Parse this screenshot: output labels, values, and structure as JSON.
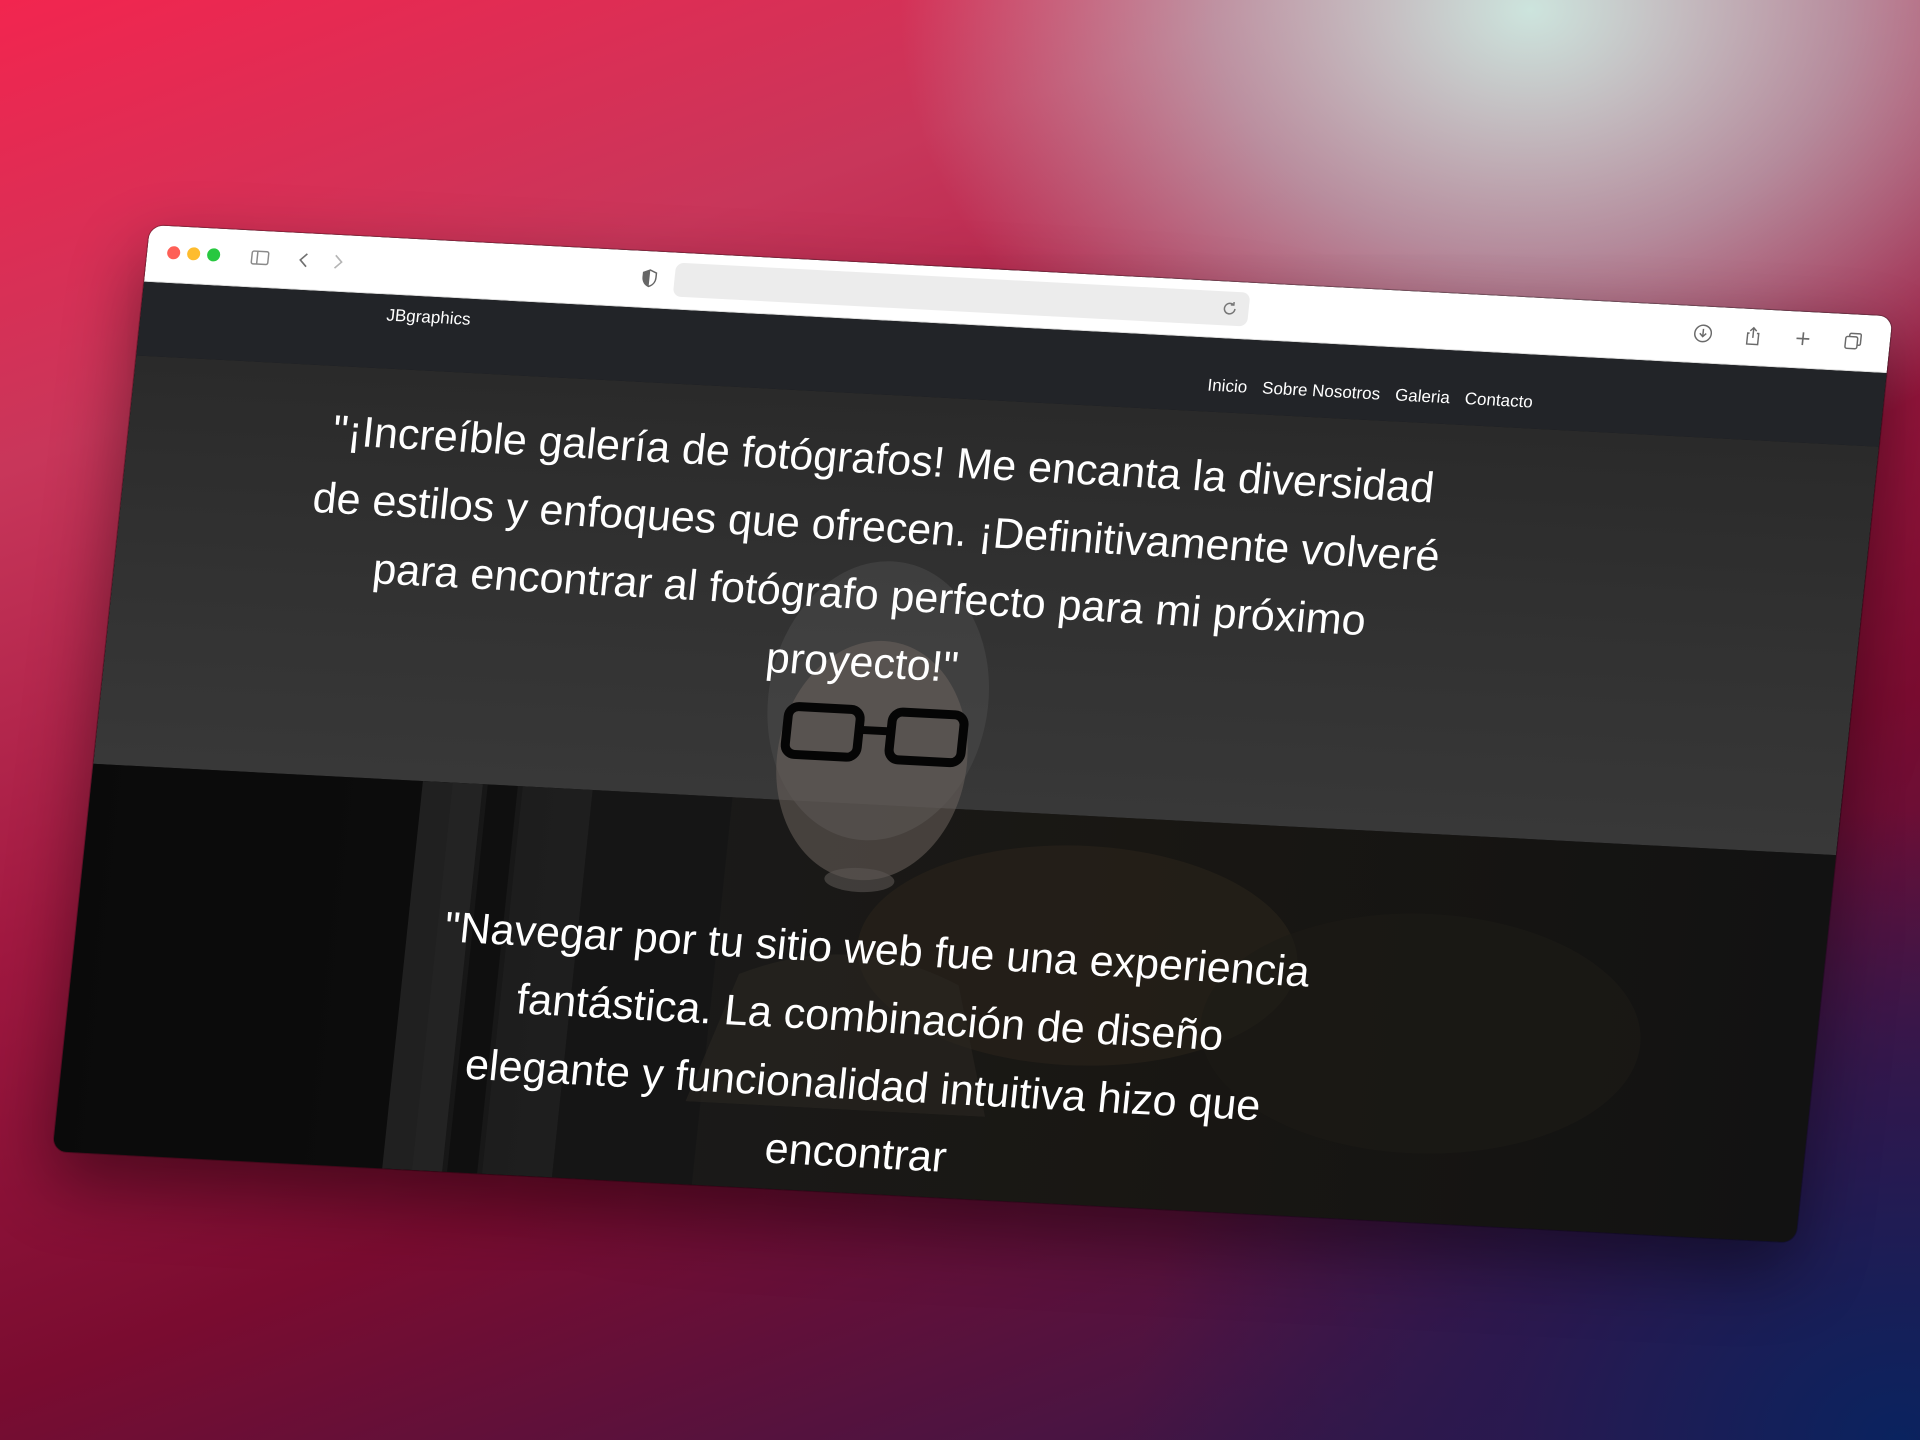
{
  "browser": {
    "toolbar": {
      "icons": [
        "sidebar-icon",
        "back-icon",
        "forward-icon",
        "shield-icon",
        "reload-icon",
        "download-icon",
        "share-icon",
        "new-tab-icon",
        "tabs-overview-icon"
      ],
      "address_value": ""
    }
  },
  "site": {
    "brand": "JBgraphics",
    "nav": [
      "Inicio",
      "Sobre Nosotros",
      "Galeria",
      "Contacto"
    ]
  },
  "testimonials": [
    {
      "text": "\"¡Increíble galería de fotógrafos! Me encanta la diversidad de estilos y enfoques que ofrecen. ¡Definitivamente volveré para encontrar al fotógrafo perfecto para mi próximo proyecto!\""
    },
    {
      "text": "\"Navegar por tu sitio web fue una experiencia fantástica. La combinación de diseño elegante y funcionalidad intuitiva hizo que encontrar"
    }
  ],
  "colors": {
    "navbar_bg": "#222428",
    "text": "#ffffff",
    "accent_red": "#fe5f57",
    "accent_yellow": "#febc2e",
    "accent_green": "#28c840"
  }
}
